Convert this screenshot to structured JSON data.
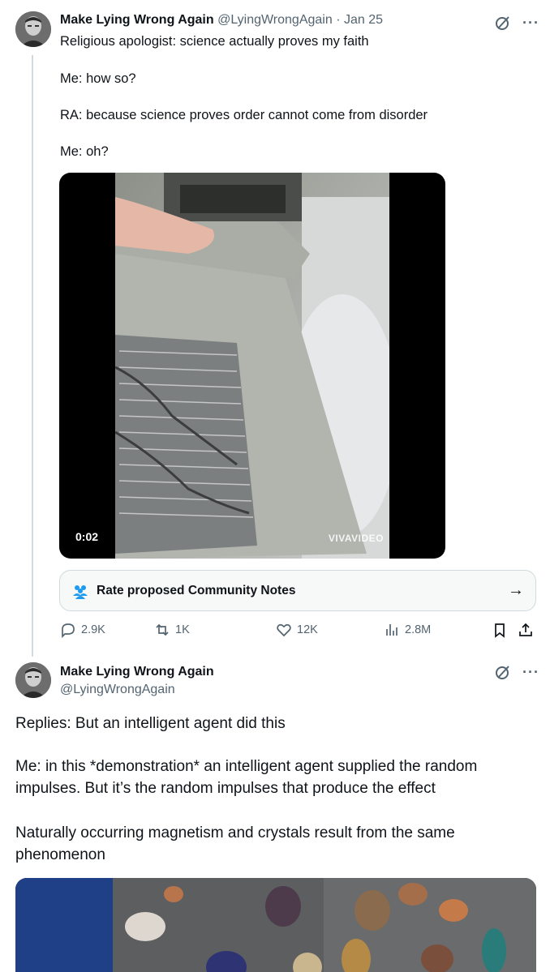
{
  "tweet1": {
    "name": "Make Lying Wrong Again",
    "handle": "@LyingWrongAgain",
    "separator": "·",
    "date": "Jan 25",
    "lines": [
      "Religious apologist: science actually proves my faith",
      "Me: how so?",
      "RA: because science proves order cannot come from disorder",
      "Me: oh?"
    ],
    "video": {
      "timestamp": "0:02",
      "watermark": "VIVAVIDEO"
    },
    "community_notes": {
      "label": "Rate proposed Community Notes",
      "arrow": "→"
    },
    "actions": {
      "replies": "2.9K",
      "reposts": "1K",
      "likes": "12K",
      "views": "2.8M"
    }
  },
  "tweet2": {
    "name": "Make Lying Wrong Again",
    "handle": "@LyingWrongAgain",
    "lines": [
      "Replies: But an intelligent agent did this",
      "Me: in this *demonstration* an intelligent agent supplied the random",
      "impulses. But it’s the random impulses that produce the effect",
      "Naturally occurring magnetism and crystals result from the same",
      "phenomenon"
    ]
  },
  "colors": {
    "text_primary": "#0f1419",
    "text_secondary": "#536471",
    "border": "#cfd9de",
    "accent_blue": "#1d9bf0"
  },
  "icons": {
    "grok": "grok-icon",
    "more": "more-icon",
    "reply": "reply-icon",
    "repost": "repost-icon",
    "like": "heart-icon",
    "views": "views-icon",
    "bookmark": "bookmark-icon",
    "share": "share-icon",
    "community": "people-icon"
  }
}
